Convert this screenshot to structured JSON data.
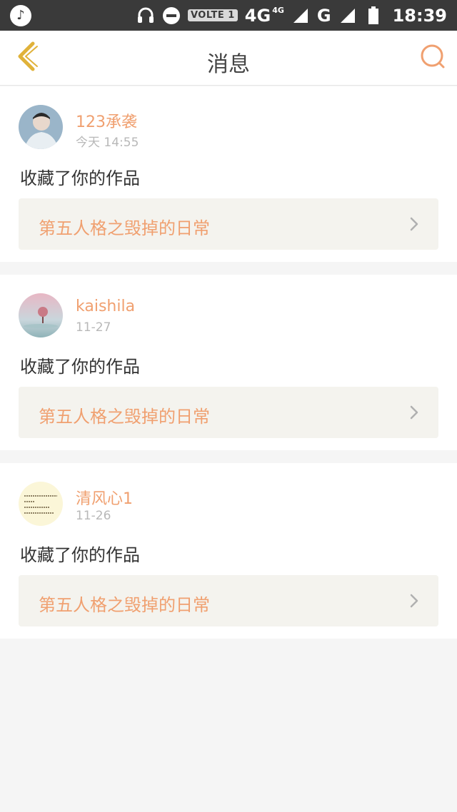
{
  "status_bar": {
    "network_4g": "4G",
    "network_4g_small": "4G",
    "network_g": "G",
    "volte": "VOLTE 1",
    "time": "18:39"
  },
  "header": {
    "title": "消息"
  },
  "notifications": [
    {
      "username": "123承袭",
      "time": "今天 14:55",
      "action": "收藏了你的作品",
      "work_title": "第五人格之毁掉的日常"
    },
    {
      "username": "kaishila",
      "time": "11-27",
      "action": "收藏了你的作品",
      "work_title": "第五人格之毁掉的日常"
    },
    {
      "username": "清风心1",
      "time": "11-26",
      "action": "收藏了你的作品",
      "work_title": "第五人格之毁掉的日常"
    }
  ],
  "colors": {
    "accent": "#f0a070",
    "back_icon": "#e0b23a",
    "background": "#f5f5f5",
    "status_bar": "#3a3a3a"
  }
}
